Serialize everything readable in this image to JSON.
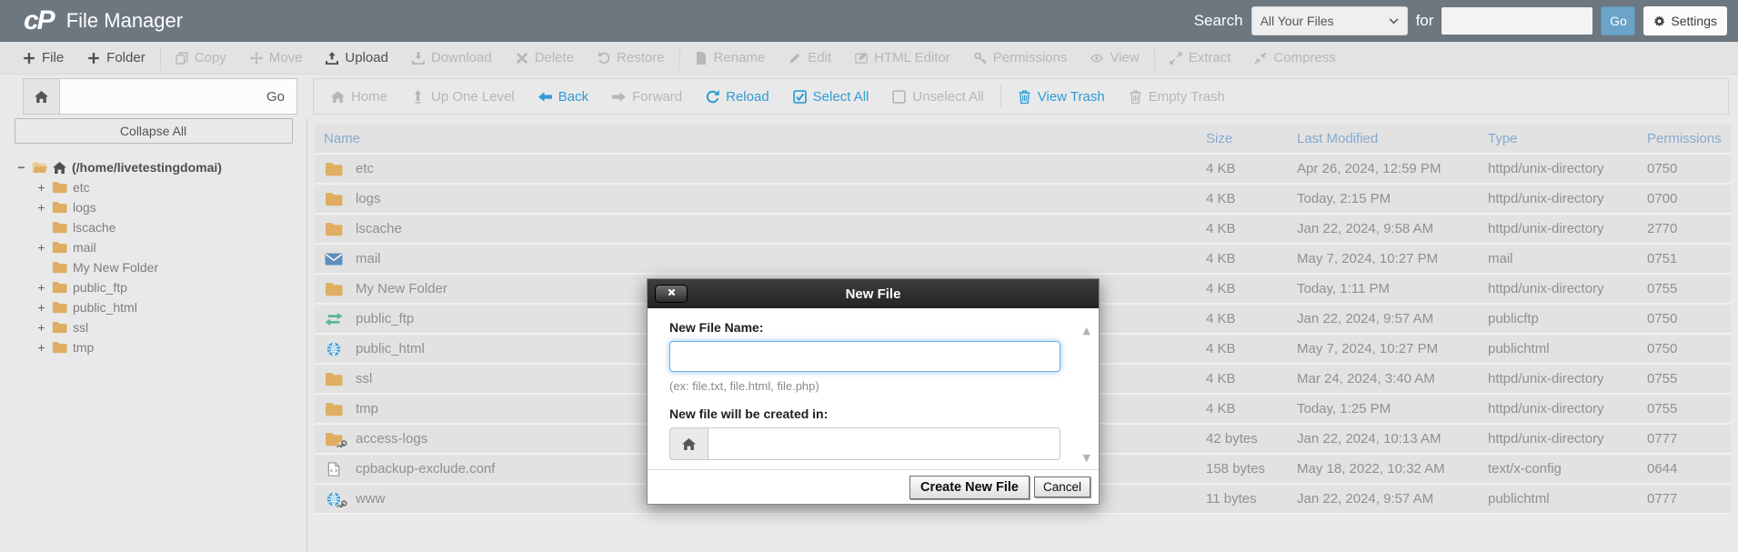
{
  "header": {
    "logo_text": "cP",
    "title": "File Manager",
    "search_label": "Search",
    "search_scope": "All Your Files",
    "for_label": "for",
    "search_value": "",
    "go_label": "Go",
    "settings_label": "Settings"
  },
  "toolbar": {
    "items": [
      {
        "label": "File",
        "icon": "plus",
        "enabled": true
      },
      {
        "label": "Folder",
        "icon": "plus",
        "enabled": true
      },
      {
        "label": "Copy",
        "icon": "copy",
        "enabled": false,
        "divider_before": true
      },
      {
        "label": "Move",
        "icon": "move",
        "enabled": false
      },
      {
        "label": "Upload",
        "icon": "upload",
        "enabled": true
      },
      {
        "label": "Download",
        "icon": "download",
        "enabled": false
      },
      {
        "label": "Delete",
        "icon": "delete",
        "enabled": false
      },
      {
        "label": "Restore",
        "icon": "restore",
        "enabled": false
      },
      {
        "label": "Rename",
        "icon": "rename",
        "enabled": false,
        "divider_before": true
      },
      {
        "label": "Edit",
        "icon": "edit",
        "enabled": false
      },
      {
        "label": "HTML Editor",
        "icon": "html-editor",
        "enabled": false
      },
      {
        "label": "Permissions",
        "icon": "key",
        "enabled": false
      },
      {
        "label": "View",
        "icon": "eye",
        "enabled": false
      },
      {
        "label": "Extract",
        "icon": "extract",
        "enabled": false,
        "divider_before": true
      },
      {
        "label": "Compress",
        "icon": "compress",
        "enabled": false
      }
    ]
  },
  "navbar": {
    "path_value": "",
    "path_go_label": "Go",
    "items": [
      {
        "label": "Home",
        "icon": "home",
        "state": "dis"
      },
      {
        "label": "Up One Level",
        "icon": "up-level",
        "state": "dis"
      },
      {
        "label": "Back",
        "icon": "back-arrow",
        "state": "blue"
      },
      {
        "label": "Forward",
        "icon": "forward-arrow",
        "state": "dis"
      },
      {
        "label": "Reload",
        "icon": "reload",
        "state": "blue"
      },
      {
        "label": "Select All",
        "icon": "checkbox-checked",
        "state": "blue"
      },
      {
        "label": "Unselect All",
        "icon": "checkbox-empty",
        "state": "dis"
      },
      {
        "label": "View Trash",
        "icon": "trash",
        "state": "blue",
        "divider_before": true
      },
      {
        "label": "Empty Trash",
        "icon": "trash",
        "state": "dis"
      }
    ]
  },
  "sidebar": {
    "collapse_all_label": "Collapse All",
    "root_label": "(/home/livetestingdomai)",
    "items": [
      {
        "label": "etc",
        "expandable": true
      },
      {
        "label": "logs",
        "expandable": true
      },
      {
        "label": "lscache",
        "expandable": false
      },
      {
        "label": "mail",
        "expandable": true
      },
      {
        "label": "My New Folder",
        "expandable": false
      },
      {
        "label": "public_ftp",
        "expandable": true
      },
      {
        "label": "public_html",
        "expandable": true
      },
      {
        "label": "ssl",
        "expandable": true
      },
      {
        "label": "tmp",
        "expandable": true
      }
    ]
  },
  "table": {
    "columns": [
      "Name",
      "Size",
      "Last Modified",
      "Type",
      "Permissions"
    ],
    "rows": [
      {
        "name": "etc",
        "icon": "folder",
        "size": "4 KB",
        "modified": "Apr 26, 2024, 12:59 PM",
        "type": "httpd/unix-directory",
        "permissions": "0750"
      },
      {
        "name": "logs",
        "icon": "folder",
        "size": "4 KB",
        "modified": "Today, 2:15 PM",
        "type": "httpd/unix-directory",
        "permissions": "0700"
      },
      {
        "name": "lscache",
        "icon": "folder",
        "size": "4 KB",
        "modified": "Jan 22, 2024, 9:58 AM",
        "type": "httpd/unix-directory",
        "permissions": "2770"
      },
      {
        "name": "mail",
        "icon": "mail",
        "size": "4 KB",
        "modified": "May 7, 2024, 10:27 PM",
        "type": "mail",
        "permissions": "0751"
      },
      {
        "name": "My New Folder",
        "icon": "folder",
        "size": "4 KB",
        "modified": "Today, 1:11 PM",
        "type": "httpd/unix-directory",
        "permissions": "0755"
      },
      {
        "name": "public_ftp",
        "icon": "ftp",
        "size": "4 KB",
        "modified": "Jan 22, 2024, 9:57 AM",
        "type": "publicftp",
        "permissions": "0750"
      },
      {
        "name": "public_html",
        "icon": "globe",
        "size": "4 KB",
        "modified": "May 7, 2024, 10:27 PM",
        "type": "publichtml",
        "permissions": "0750"
      },
      {
        "name": "ssl",
        "icon": "folder",
        "size": "4 KB",
        "modified": "Mar 24, 2024, 3:40 AM",
        "type": "httpd/unix-directory",
        "permissions": "0755"
      },
      {
        "name": "tmp",
        "icon": "folder",
        "size": "4 KB",
        "modified": "Today, 1:25 PM",
        "type": "httpd/unix-directory",
        "permissions": "0755"
      },
      {
        "name": "access-logs",
        "icon": "folder-link",
        "size": "42 bytes",
        "modified": "Jan 22, 2024, 10:13 AM",
        "type": "httpd/unix-directory",
        "permissions": "0777"
      },
      {
        "name": "cpbackup-exclude.conf",
        "icon": "config-file",
        "size": "158 bytes",
        "modified": "May 18, 2022, 10:32 AM",
        "type": "text/x-config",
        "permissions": "0644"
      },
      {
        "name": "www",
        "icon": "globe-link",
        "size": "11 bytes",
        "modified": "Jan 22, 2024, 9:57 AM",
        "type": "publichtml",
        "permissions": "0777"
      }
    ]
  },
  "modal": {
    "title": "New File",
    "name_label": "New File Name:",
    "name_value": "",
    "hint": "(ex: file.txt, file.html, file.php)",
    "created_in_label": "New file will be created in:",
    "created_in_value": "",
    "create_label": "Create New File",
    "cancel_label": "Cancel"
  },
  "colors": {
    "topbar_bg": "#6c7780",
    "toolbar_bg": "#e3e3e3",
    "action_blue": "#2f9cd5",
    "go_button_blue": "#6ba3c9",
    "table_header_blue": "#86a9cd",
    "folder_tan": "#dfae63",
    "mail_blue": "#5d8fbc",
    "ftp_green": "#53b893",
    "globe_blue": "#4a9fd8",
    "modal_header_dark": "#2e2e2e",
    "focus_glow_blue": "#66afe9"
  }
}
